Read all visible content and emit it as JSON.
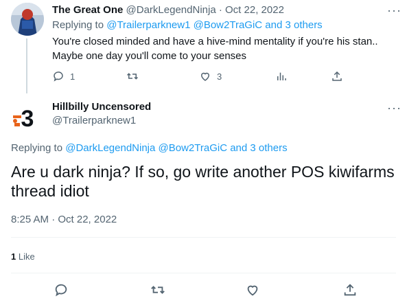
{
  "reply_tweet": {
    "author_name": "The Great One",
    "author_handle": "@DarkLegendNinja",
    "separator": "·",
    "date": "Oct 22, 2022",
    "replying_prefix": "Replying to",
    "replying_to": "@Trailerparknew1 @Bow2TraGiC and 3 others",
    "text": "You're closed minded and have a hive-mind mentality if you're his stan.. Maybe one day you'll come to your senses",
    "reply_count": "1",
    "retweet_count": "",
    "like_count": "3",
    "more_label": "···",
    "icons": [
      "reply-icon",
      "retweet-icon",
      "like-icon",
      "analytics-icon",
      "share-icon"
    ]
  },
  "main_tweet": {
    "author_name": "Hillbilly Uncensored",
    "author_handle": "@Trailerparknew1",
    "more_label": "···",
    "replying_prefix": "Replying to",
    "replying_to": "@DarkLegendNinja @Bow2TraGiC and 3 others",
    "text": "Are u dark ninja? If so, go write another POS kiwifarms thread idiot",
    "timestamp": "8:25 AM · Oct 22, 2022",
    "likes_count": "1",
    "likes_label": "Like",
    "icons": [
      "reply-icon",
      "retweet-icon",
      "like-icon",
      "share-icon"
    ]
  },
  "colors": {
    "link": "#1d9bf0",
    "muted": "#536471",
    "text": "#0f1419",
    "divider": "#eff3f4",
    "avatar_accent": "#e8631a"
  }
}
